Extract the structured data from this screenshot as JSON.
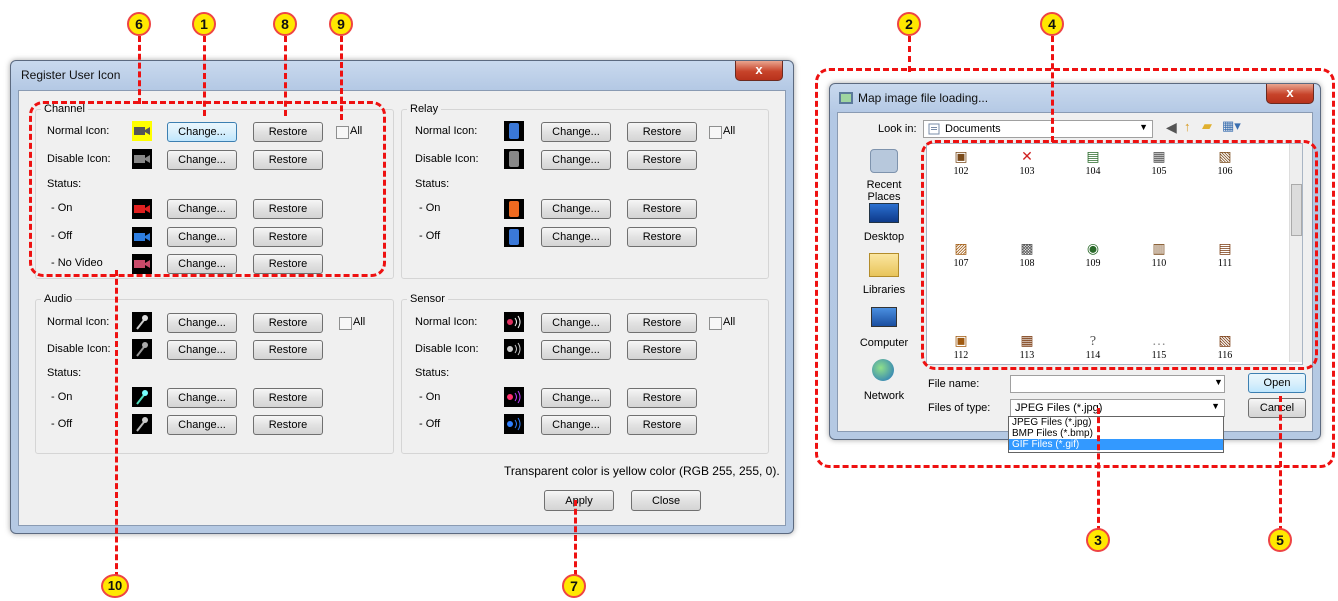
{
  "register": {
    "title": "Register User Icon",
    "close_label": "x",
    "channel": {
      "title": "Channel",
      "normal": "Normal Icon:",
      "disable": "Disable Icon:",
      "status": "Status:",
      "on": "- On",
      "off": "- Off",
      "novideo": "- No Video",
      "all": "All"
    },
    "relay": {
      "title": "Relay",
      "normal": "Normal Icon:",
      "disable": "Disable Icon:",
      "status": "Status:",
      "on": "- On",
      "off": "- Off",
      "all": "All"
    },
    "audio": {
      "title": "Audio",
      "normal": "Normal Icon:",
      "disable": "Disable Icon:",
      "status": "Status:",
      "on": "- On",
      "off": "- Off",
      "all": "All"
    },
    "sensor": {
      "title": "Sensor",
      "normal": "Normal Icon:",
      "disable": "Disable Icon:",
      "status": "Status:",
      "on": "- On",
      "off": "- Off",
      "all": "All"
    },
    "change_label": "Change...",
    "restore_label": "Restore",
    "note": "Transparent color is yellow color (RGB 255, 255, 0).",
    "apply": "Apply",
    "close": "Close"
  },
  "fileDialog": {
    "title": "Map image file loading...",
    "close_label": "x",
    "look_in_label": "Look in:",
    "look_in_value": "Documents",
    "places": [
      "Recent Places",
      "Desktop",
      "Libraries",
      "Computer",
      "Network"
    ],
    "files": [
      "102",
      "103",
      "104",
      "105",
      "106",
      "107",
      "108",
      "109",
      "110",
      "111",
      "112",
      "113",
      "114",
      "115",
      "116"
    ],
    "file_name_label": "File name:",
    "file_name_value": "",
    "file_type_label": "Files of type:",
    "file_type_value": "JPEG Files (*.jpg)",
    "type_options": [
      "JPEG Files (*.jpg)",
      "BMP Files (*.bmp)",
      "GIF Files (*.gif)"
    ],
    "open": "Open",
    "cancel": "Cancel"
  },
  "callouts": [
    "1",
    "2",
    "3",
    "4",
    "5",
    "6",
    "7",
    "8",
    "9",
    "10"
  ],
  "colors": {
    "callout_fill": "#ffe800",
    "callout_line": "#ee1111",
    "selection": "#3399ff"
  }
}
